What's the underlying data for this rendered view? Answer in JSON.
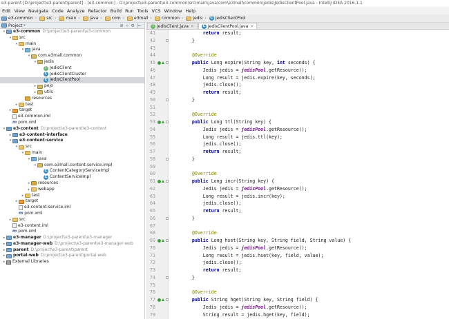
{
  "window": {
    "title": "e3-parent [D:\\project\\e3-parent\\parent] - [e3-common] - D:\\project\\e3-parent\\e3-common\\src\\main\\java\\com\\e3mall\\common\\jedis\\JedisClientPool.java - IntelliJ IDEA 2016.1.1"
  },
  "menu": [
    "Edit",
    "View",
    "Navigate",
    "Code",
    "Analyze",
    "Refactor",
    "Build",
    "Run",
    "Tools",
    "VCS",
    "Window",
    "Help"
  ],
  "breadcrumbs": [
    "e3-common",
    "src",
    "main",
    "java",
    "com",
    "e3mall",
    "common",
    "jedis",
    "JedisClientPool"
  ],
  "project_panel": {
    "label": "Project",
    "tools": [
      "⊕",
      "÷",
      "⚙",
      "|←"
    ],
    "tree": [
      {
        "label": "e3-common",
        "path": "D:\\project\\e3-parent\\e3-common",
        "icon": "module-icon",
        "indent": 0,
        "arrow": "▾",
        "bold": true
      },
      {
        "label": "src",
        "icon": "folder-icon",
        "indent": 1,
        "arrow": "▾"
      },
      {
        "label": "main",
        "icon": "folder-icon",
        "indent": 2,
        "arrow": "▾"
      },
      {
        "label": "java",
        "icon": "source-folder-icon",
        "indent": 3,
        "arrow": "▾"
      },
      {
        "label": "com.e3mall.common",
        "icon": "package-icon",
        "indent": 4,
        "arrow": "▾"
      },
      {
        "label": "jedis",
        "icon": "package-icon",
        "indent": 5,
        "arrow": "▾"
      },
      {
        "label": "JedisClient",
        "icon": "interface-icon",
        "indent": 6,
        "arrow": ""
      },
      {
        "label": "JedisClientCluster",
        "icon": "class-icon",
        "indent": 6,
        "arrow": ""
      },
      {
        "label": "JedisClientPool",
        "icon": "class-icon",
        "indent": 6,
        "arrow": "",
        "selected": true
      },
      {
        "label": "pojo",
        "icon": "package-icon",
        "indent": 5,
        "arrow": "▸"
      },
      {
        "label": "utils",
        "icon": "package-icon",
        "indent": 5,
        "arrow": "▸"
      },
      {
        "label": "resources",
        "icon": "resources-icon",
        "indent": 3,
        "arrow": ""
      },
      {
        "label": "test",
        "icon": "folder-icon",
        "indent": 2,
        "arrow": "▸"
      },
      {
        "label": "target",
        "icon": "target-folder-icon",
        "indent": 1,
        "arrow": "▸"
      },
      {
        "label": "e3-common.iml",
        "icon": "iml-file-icon",
        "indent": 1,
        "arrow": ""
      },
      {
        "label": "pom.xml",
        "icon": "maven-pom-icon",
        "indent": 1,
        "arrow": ""
      },
      {
        "label": "e3-content",
        "path": "D:\\project\\e3-parent\\e3-content",
        "icon": "module-icon",
        "indent": 0,
        "arrow": "▾",
        "bold": true
      },
      {
        "label": "e3-content-interface",
        "icon": "module-icon",
        "indent": 1,
        "arrow": "▸",
        "bold": true
      },
      {
        "label": "e3-content-service",
        "icon": "module-icon",
        "indent": 1,
        "arrow": "▾",
        "bold": true
      },
      {
        "label": "src",
        "icon": "folder-icon",
        "indent": 2,
        "arrow": "▾"
      },
      {
        "label": "main",
        "icon": "folder-icon",
        "indent": 3,
        "arrow": "▾"
      },
      {
        "label": "java",
        "icon": "source-folder-icon",
        "indent": 4,
        "arrow": "▾"
      },
      {
        "label": "com.e3mall.content.service.impl",
        "icon": "package-icon",
        "indent": 5,
        "arrow": "▾"
      },
      {
        "label": "ContentCategoryServiceImpl",
        "icon": "class-icon",
        "indent": 6,
        "arrow": ""
      },
      {
        "label": "ContentServiceImpl",
        "icon": "class-icon",
        "indent": 6,
        "arrow": ""
      },
      {
        "label": "resources",
        "icon": "resources-icon",
        "indent": 4,
        "arrow": "▸"
      },
      {
        "label": "webapp",
        "icon": "folder-icon",
        "indent": 4,
        "arrow": "▸"
      },
      {
        "label": "test",
        "icon": "folder-icon",
        "indent": 3,
        "arrow": "▸"
      },
      {
        "label": "target",
        "icon": "target-folder-icon",
        "indent": 2,
        "arrow": "▸"
      },
      {
        "label": "e3-content-service.iml",
        "icon": "iml-file-icon",
        "indent": 2,
        "arrow": ""
      },
      {
        "label": "pom.xml",
        "icon": "maven-pom-icon",
        "indent": 2,
        "arrow": ""
      },
      {
        "label": "src",
        "icon": "folder-icon",
        "indent": 1,
        "arrow": "▸"
      },
      {
        "label": "e3-content.iml",
        "icon": "iml-file-icon",
        "indent": 1,
        "arrow": ""
      },
      {
        "label": "pom.xml",
        "icon": "maven-pom-icon",
        "indent": 1,
        "arrow": ""
      },
      {
        "label": "e3-manager",
        "path": "D:\\project\\e3-parent\\e3-manager",
        "icon": "module-icon",
        "indent": 0,
        "arrow": "▸",
        "bold": true
      },
      {
        "label": "e3-manager-web",
        "path": "D:\\project\\e3-parent\\e3-manager-web",
        "icon": "module-icon",
        "indent": 0,
        "arrow": "▸",
        "bold": true
      },
      {
        "label": "parent",
        "path": "D:\\project\\e3-parent\\parent",
        "icon": "module-icon",
        "indent": 0,
        "arrow": "▸",
        "bold": true
      },
      {
        "label": "portal-web",
        "path": "D:\\project\\e3-parent\\portal-web",
        "icon": "module-icon",
        "indent": 0,
        "arrow": "▸",
        "bold": true
      },
      {
        "label": "External Libraries",
        "icon": "library-icon",
        "indent": 0,
        "arrow": "▸"
      }
    ]
  },
  "editor": {
    "tabs": [
      {
        "label": "JedisClient.java",
        "active": false
      },
      {
        "label": "JedisClientPool.java",
        "active": true
      }
    ],
    "lines": [
      {
        "n": "41",
        "gutter": "",
        "fold": false,
        "html": "        <span class=\"kw\">return</span> result;"
      },
      {
        "n": "42",
        "gutter": "",
        "fold": true,
        "html": "    }"
      },
      {
        "n": "43",
        "gutter": "",
        "fold": false,
        "html": ""
      },
      {
        "n": "44",
        "gutter": "",
        "fold": false,
        "html": "    <span class=\"ann\">@Override</span>"
      },
      {
        "n": "45",
        "gutter": "impl",
        "fold": true,
        "html": "    <span class=\"kw\">public</span> Long expire(String key, <span class=\"kw\">int</span> seconds) {"
      },
      {
        "n": "46",
        "gutter": "",
        "fold": false,
        "html": "        Jedis jedis = <span class=\"fld\">jedisPool</span>.getResource();"
      },
      {
        "n": "47",
        "gutter": "",
        "fold": false,
        "html": "        Long result = jedis.expire(key, seconds);"
      },
      {
        "n": "48",
        "gutter": "",
        "fold": false,
        "html": "        jedis.close();"
      },
      {
        "n": "49",
        "gutter": "",
        "fold": false,
        "html": "        <span class=\"kw\">return</span> result;"
      },
      {
        "n": "50",
        "gutter": "",
        "fold": true,
        "html": "    }"
      },
      {
        "n": "51",
        "gutter": "",
        "fold": false,
        "html": ""
      },
      {
        "n": "52",
        "gutter": "",
        "fold": false,
        "html": "    <span class=\"ann\">@Override</span>"
      },
      {
        "n": "53",
        "gutter": "impl",
        "fold": true,
        "html": "    <span class=\"kw\">public</span> Long ttl(String key) {"
      },
      {
        "n": "54",
        "gutter": "",
        "fold": false,
        "html": "        Jedis jedis = <span class=\"fld\">jedisPool</span>.getResource();"
      },
      {
        "n": "55",
        "gutter": "",
        "fold": false,
        "html": "        Long result = jedis.ttl(key);"
      },
      {
        "n": "56",
        "gutter": "",
        "fold": false,
        "html": "        jedis.close();"
      },
      {
        "n": "57",
        "gutter": "",
        "fold": false,
        "html": "        <span class=\"kw\">return</span> result;"
      },
      {
        "n": "58",
        "gutter": "",
        "fold": true,
        "html": "    }"
      },
      {
        "n": "59",
        "gutter": "",
        "fold": false,
        "html": ""
      },
      {
        "n": "60",
        "gutter": "",
        "fold": false,
        "html": "    <span class=\"ann\">@Override</span>"
      },
      {
        "n": "61",
        "gutter": "impl",
        "fold": true,
        "html": "    <span class=\"kw\">public</span> Long incr(String key) {"
      },
      {
        "n": "62",
        "gutter": "",
        "fold": false,
        "html": "        Jedis jedis = <span class=\"fld\">jedisPool</span>.getResource();"
      },
      {
        "n": "63",
        "gutter": "",
        "fold": false,
        "html": "        Long result = jedis.incr(key);"
      },
      {
        "n": "64",
        "gutter": "",
        "fold": false,
        "html": "        jedis.close();"
      },
      {
        "n": "65",
        "gutter": "",
        "fold": false,
        "html": "        <span class=\"kw\">return</span> result;"
      },
      {
        "n": "66",
        "gutter": "",
        "fold": true,
        "html": "    }"
      },
      {
        "n": "67",
        "gutter": "",
        "fold": false,
        "html": ""
      },
      {
        "n": "68",
        "gutter": "",
        "fold": false,
        "html": "    <span class=\"ann\">@Override</span>"
      },
      {
        "n": "69",
        "gutter": "impl",
        "fold": true,
        "html": "    <span class=\"kw\">public</span> Long hset(String key, String field, String value) {"
      },
      {
        "n": "70",
        "gutter": "",
        "fold": false,
        "html": "        Jedis jedis = <span class=\"fld\">jedisPool</span>.getResource();"
      },
      {
        "n": "71",
        "gutter": "",
        "fold": false,
        "html": "        Long result = jedis.hset(key, field, value);"
      },
      {
        "n": "72",
        "gutter": "",
        "fold": false,
        "html": "        jedis.close();"
      },
      {
        "n": "73",
        "gutter": "",
        "fold": false,
        "html": "        <span class=\"kw\">return</span> result;"
      },
      {
        "n": "74",
        "gutter": "",
        "fold": true,
        "html": "    }"
      },
      {
        "n": "75",
        "gutter": "",
        "fold": false,
        "html": ""
      },
      {
        "n": "76",
        "gutter": "",
        "fold": false,
        "html": "    <span class=\"ann\">@Override</span>"
      },
      {
        "n": "77",
        "gutter": "impl",
        "fold": true,
        "html": "    <span class=\"kw\">public</span> String hget(String key, String field) {"
      },
      {
        "n": "78",
        "gutter": "",
        "fold": false,
        "html": "        Jedis jedis = <span class=\"fld\">jedisPool</span>.getResource();"
      },
      {
        "n": "79",
        "gutter": "",
        "fold": false,
        "html": "        String result = jedis.hget(key, field);"
      }
    ]
  },
  "colors": {
    "selection": "#d4d8dd",
    "keyword": "#000080",
    "annotation": "#808000",
    "field": "#660e7a"
  }
}
